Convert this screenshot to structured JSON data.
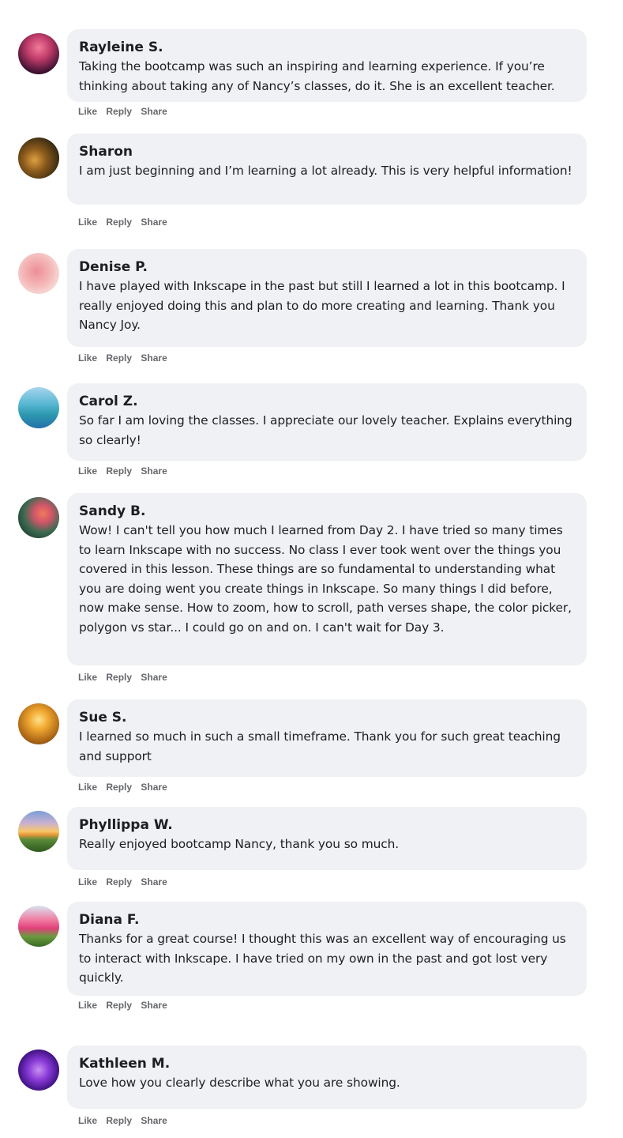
{
  "actions": {
    "like": "Like",
    "reply": "Reply",
    "share": "Share"
  },
  "comments": [
    {
      "name": "Rayleine S.",
      "text": "Taking the bootcamp was such an inspiring and learning experience. If you’re thinking about taking any of Nancy’s classes, do it. She is an excellent teacher.",
      "avatar_colors": [
        "#e05a7a",
        "#3b1030"
      ]
    },
    {
      "name": "Sharon",
      "text": "I am just beginning and I’m learning a lot already. This is very helpful information!",
      "avatar_colors": [
        "#c7842c",
        "#2a2210"
      ]
    },
    {
      "name": "Denise P.",
      "text": "I have played with Inkscape in the past but still I learned a lot in this bootcamp. I really enjoyed doing this and plan to do more creating and learning. Thank you Nancy Joy.",
      "avatar_colors": [
        "#f2a3a8",
        "#f7e1dc"
      ]
    },
    {
      "name": "Carol Z.",
      "text": "So far I am loving the classes. I appreciate our lovely teacher. Explains everything so clearly!",
      "avatar_colors": [
        "#59c4c8",
        "#2b7ab4"
      ]
    },
    {
      "name": "Sandy B.",
      "text": "Wow! I can't tell you how much I learned from Day 2. I have tried so many times to learn Inkscape with no success. No class I ever took went over the things you covered in this lesson. These things are so fundamental to understanding what you are doing went you create things in Inkscape. So many things I did before, now make sense. How to zoom, how to scroll, path verses shape, the color picker, polygon vs star... I could go on and on. I can't wait for Day 3.",
      "avatar_colors": [
        "#e06a50",
        "#274a3a"
      ]
    },
    {
      "name": "Sue S.",
      "text": "I learned so much in such a small timeframe. Thank you for such great teaching and support",
      "avatar_colors": [
        "#f0b23a",
        "#6a3d0c"
      ]
    },
    {
      "name": "Phyllippa W.",
      "text": "Really enjoyed bootcamp Nancy, thank you so much.",
      "avatar_colors": [
        "#f6c060",
        "#5a78a8"
      ]
    },
    {
      "name": "Diana F.",
      "text": "Thanks for a great course! I thought this was an excellent way of encouraging us to interact with Inkscape. I have tried on my own in the past and got lost very quickly.",
      "avatar_colors": [
        "#e84c7c",
        "#5a8a3a"
      ]
    },
    {
      "name": "Kathleen M.",
      "text": "Love how you clearly describe what you are showing.",
      "avatar_colors": [
        "#8a3ad8",
        "#1c0a3a"
      ]
    }
  ]
}
